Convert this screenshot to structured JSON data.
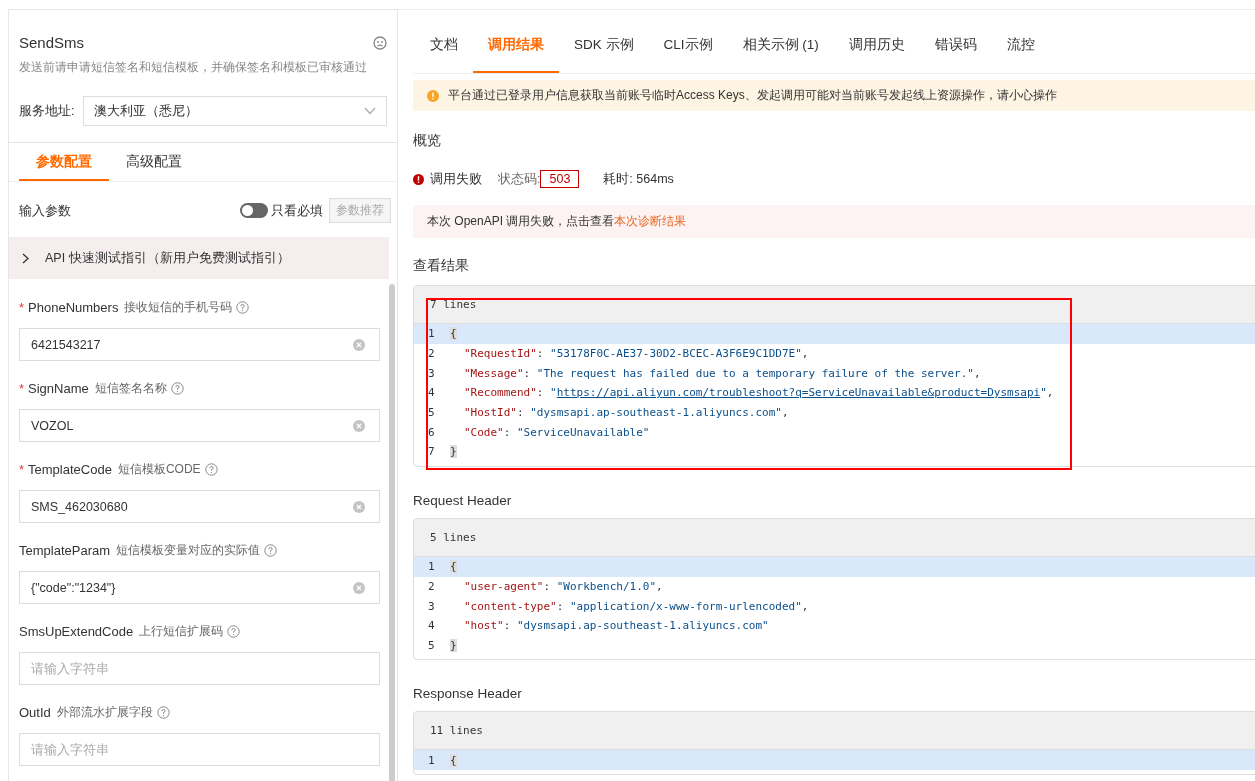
{
  "api": {
    "title": "SendSms",
    "description": "发送前请申请短信签名和短信模板，并确保签名和模板已审核通过"
  },
  "service": {
    "label": "服务地址:",
    "value": "澳大利亚（悉尼）"
  },
  "config_tabs": [
    {
      "label": "参数配置",
      "selected": true
    },
    {
      "label": "高级配置",
      "selected": false
    }
  ],
  "input_params": {
    "title": "输入参数",
    "required_only": {
      "label": "只看必填",
      "on": false
    },
    "recommend_button": {
      "label": "参数推荐",
      "disabled": true
    }
  },
  "guide": {
    "label": "API 快速测试指引（新用户免费测试指引）",
    "expanded": false
  },
  "required_mark": "*",
  "fields": [
    {
      "name": "PhoneNumbers",
      "hint": "接收短信的手机号码",
      "required": true,
      "value": "6421543217"
    },
    {
      "name": "SignName",
      "hint": "短信签名名称",
      "required": true,
      "value": "VOZOL"
    },
    {
      "name": "TemplateCode",
      "hint": "短信模板CODE",
      "required": true,
      "value": "SMS_462030680"
    },
    {
      "name": "TemplateParam",
      "hint": "短信模板变量对应的实际值",
      "required": false,
      "value": "{\"code\":\"1234\"}"
    },
    {
      "name": "SmsUpExtendCode",
      "hint": "上行短信扩展码",
      "required": false,
      "placeholder": "请输入字符串"
    },
    {
      "name": "OutId",
      "hint": "外部流水扩展字段",
      "required": false,
      "placeholder": "请输入字符串"
    }
  ],
  "tabs": [
    {
      "label": "文档",
      "selected": false
    },
    {
      "label": "调用结果",
      "selected": true
    },
    {
      "label": "SDK 示例",
      "selected": false
    },
    {
      "label": "CLI示例",
      "selected": false
    },
    {
      "label": "相关示例 (1)",
      "selected": false
    },
    {
      "label": "调用历史",
      "selected": false
    },
    {
      "label": "错误码",
      "selected": false
    },
    {
      "label": "流控",
      "selected": false
    }
  ],
  "warning": "平台通过已登录用户信息获取当前账号临时Access Keys、发起调用可能对当前账号发起线上资源操作，请小心操作",
  "overview": {
    "title": "概览",
    "status": "调用失败",
    "status_code_label": "状态码:",
    "status_code": "503",
    "duration": "耗时: 564ms"
  },
  "diagnosis": {
    "text": "本次 OpenAPI 调用失败，点击查看",
    "link": "本次诊断结果"
  },
  "sections": [
    {
      "title": "查看结果",
      "line_count": "7 lines",
      "annotated": true,
      "lines": [
        {
          "number": "1",
          "kind": "brace",
          "highlighted": true,
          "tokens": [
            {
              "kind": "bracket",
              "text": "{"
            }
          ]
        },
        {
          "number": "2",
          "kind": "member",
          "highlighted": false,
          "tokens": [
            {
              "kind": "key",
              "text": "\"RequestId\""
            },
            {
              "kind": "punct",
              "text": ": "
            },
            {
              "kind": "string",
              "text": "\"53178F0C-AE37-30D2-BCEC-A3F6E9C1DD7E\""
            },
            {
              "kind": "punct",
              "text": ","
            }
          ]
        },
        {
          "number": "3",
          "kind": "member",
          "highlighted": false,
          "tokens": [
            {
              "kind": "key",
              "text": "\"Message\""
            },
            {
              "kind": "punct",
              "text": ": "
            },
            {
              "kind": "string",
              "text": "\"The request has failed due to a temporary failure of the server.\""
            },
            {
              "kind": "punct",
              "text": ","
            }
          ]
        },
        {
          "number": "4",
          "kind": "member",
          "highlighted": false,
          "tokens": [
            {
              "kind": "key",
              "text": "\"Recommend\""
            },
            {
              "kind": "punct",
              "text": ": "
            },
            {
              "kind": "string",
              "text": "\""
            },
            {
              "kind": "link",
              "text": "https://api.aliyun.com/troubleshoot?q=ServiceUnavailable&product=Dysmsapi"
            },
            {
              "kind": "string",
              "text": "\""
            },
            {
              "kind": "punct",
              "text": ","
            }
          ]
        },
        {
          "number": "5",
          "kind": "member",
          "highlighted": false,
          "tokens": [
            {
              "kind": "key",
              "text": "\"HostId\""
            },
            {
              "kind": "punct",
              "text": ": "
            },
            {
              "kind": "string",
              "text": "\"dysmsapi.ap-southeast-1.aliyuncs.com\""
            },
            {
              "kind": "punct",
              "text": ","
            }
          ]
        },
        {
          "number": "6",
          "kind": "member",
          "highlighted": false,
          "tokens": [
            {
              "kind": "key",
              "text": "\"Code\""
            },
            {
              "kind": "punct",
              "text": ": "
            },
            {
              "kind": "string",
              "text": "\"ServiceUnavailable\""
            }
          ]
        },
        {
          "number": "7",
          "kind": "brace",
          "highlighted": false,
          "tokens": [
            {
              "kind": "bracket",
              "text": "}"
            }
          ]
        }
      ]
    },
    {
      "title": "Request Header",
      "line_count": "5 lines",
      "annotated": false,
      "lines": [
        {
          "number": "1",
          "kind": "brace",
          "highlighted": true,
          "tokens": [
            {
              "kind": "bracket",
              "text": "{"
            }
          ]
        },
        {
          "number": "2",
          "kind": "member",
          "highlighted": false,
          "tokens": [
            {
              "kind": "key",
              "text": "\"user-agent\""
            },
            {
              "kind": "punct",
              "text": ": "
            },
            {
              "kind": "string",
              "text": "\"Workbench/1.0\""
            },
            {
              "kind": "punct",
              "text": ","
            }
          ]
        },
        {
          "number": "3",
          "kind": "member",
          "highlighted": false,
          "tokens": [
            {
              "kind": "key",
              "text": "\"content-type\""
            },
            {
              "kind": "punct",
              "text": ": "
            },
            {
              "kind": "string",
              "text": "\"application/x-www-form-urlencoded\""
            },
            {
              "kind": "punct",
              "text": ","
            }
          ]
        },
        {
          "number": "4",
          "kind": "member",
          "highlighted": false,
          "tokens": [
            {
              "kind": "key",
              "text": "\"host\""
            },
            {
              "kind": "punct",
              "text": ": "
            },
            {
              "kind": "string",
              "text": "\"dysmsapi.ap-southeast-1.aliyuncs.com\""
            }
          ]
        },
        {
          "number": "5",
          "kind": "brace",
          "highlighted": false,
          "tokens": [
            {
              "kind": "bracket",
              "text": "}"
            }
          ]
        }
      ]
    },
    {
      "title": "Response Header",
      "line_count": "11 lines",
      "annotated": false,
      "lines": [
        {
          "number": "1",
          "kind": "brace",
          "highlighted": true,
          "tokens": [
            {
              "kind": "bracket",
              "text": "{"
            }
          ]
        }
      ]
    }
  ]
}
